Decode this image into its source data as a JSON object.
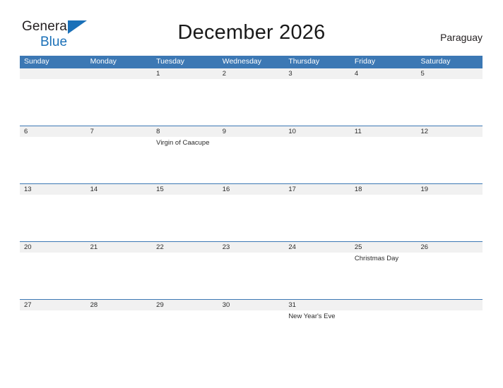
{
  "brand": {
    "word1": "General",
    "word2": "Blue",
    "triangle_color": "#1a70b8",
    "word2_color": "#1a70b8"
  },
  "header": {
    "title": "December 2026",
    "country": "Paraguay"
  },
  "colors": {
    "header_bar": "#3c78b4",
    "date_band": "#f1f1f1",
    "separator": "#3c78b4",
    "text": "#2b2b2b"
  },
  "calendar": {
    "weekdays": [
      "Sunday",
      "Monday",
      "Tuesday",
      "Wednesday",
      "Thursday",
      "Friday",
      "Saturday"
    ],
    "weeks": [
      [
        {
          "date": "",
          "event": ""
        },
        {
          "date": "",
          "event": ""
        },
        {
          "date": "1",
          "event": ""
        },
        {
          "date": "2",
          "event": ""
        },
        {
          "date": "3",
          "event": ""
        },
        {
          "date": "4",
          "event": ""
        },
        {
          "date": "5",
          "event": ""
        }
      ],
      [
        {
          "date": "6",
          "event": ""
        },
        {
          "date": "7",
          "event": ""
        },
        {
          "date": "8",
          "event": "Virgin of Caacupe"
        },
        {
          "date": "9",
          "event": ""
        },
        {
          "date": "10",
          "event": ""
        },
        {
          "date": "11",
          "event": ""
        },
        {
          "date": "12",
          "event": ""
        }
      ],
      [
        {
          "date": "13",
          "event": ""
        },
        {
          "date": "14",
          "event": ""
        },
        {
          "date": "15",
          "event": ""
        },
        {
          "date": "16",
          "event": ""
        },
        {
          "date": "17",
          "event": ""
        },
        {
          "date": "18",
          "event": ""
        },
        {
          "date": "19",
          "event": ""
        }
      ],
      [
        {
          "date": "20",
          "event": ""
        },
        {
          "date": "21",
          "event": ""
        },
        {
          "date": "22",
          "event": ""
        },
        {
          "date": "23",
          "event": ""
        },
        {
          "date": "24",
          "event": ""
        },
        {
          "date": "25",
          "event": "Christmas Day"
        },
        {
          "date": "26",
          "event": ""
        }
      ],
      [
        {
          "date": "27",
          "event": ""
        },
        {
          "date": "28",
          "event": ""
        },
        {
          "date": "29",
          "event": ""
        },
        {
          "date": "30",
          "event": ""
        },
        {
          "date": "31",
          "event": "New Year's Eve"
        },
        {
          "date": "",
          "event": ""
        },
        {
          "date": "",
          "event": ""
        }
      ]
    ]
  }
}
